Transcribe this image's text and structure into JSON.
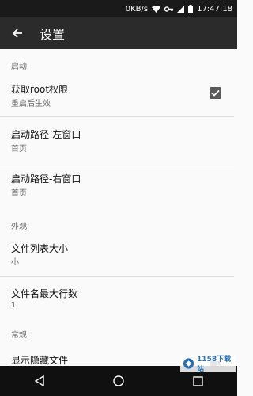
{
  "status_bar": {
    "speed": "0KB/s",
    "time": "17:47:18"
  },
  "app_bar": {
    "title": "设置"
  },
  "sections": [
    {
      "category": "启动",
      "items": [
        {
          "title": "获取root权限",
          "summary": "重启后生效",
          "checked": true
        },
        {
          "title": "启动路径-左窗口",
          "summary": "首页"
        },
        {
          "title": "启动路径-右窗口",
          "summary": "首页"
        }
      ]
    },
    {
      "category": "外观",
      "items": [
        {
          "title": "文件列表大小",
          "summary": "小"
        },
        {
          "title": "文件名最大行数",
          "summary": "1"
        }
      ]
    },
    {
      "category": "常规",
      "items": [
        {
          "title": "显示隐藏文件",
          "checked": true
        }
      ]
    }
  ],
  "watermark": {
    "text": "1158下载站"
  },
  "colors": {
    "app_bar": "#2b2b2b",
    "status_bar": "#1a1a1a",
    "nav_bar": "#101010",
    "checkbox": "#5a5a5a"
  }
}
